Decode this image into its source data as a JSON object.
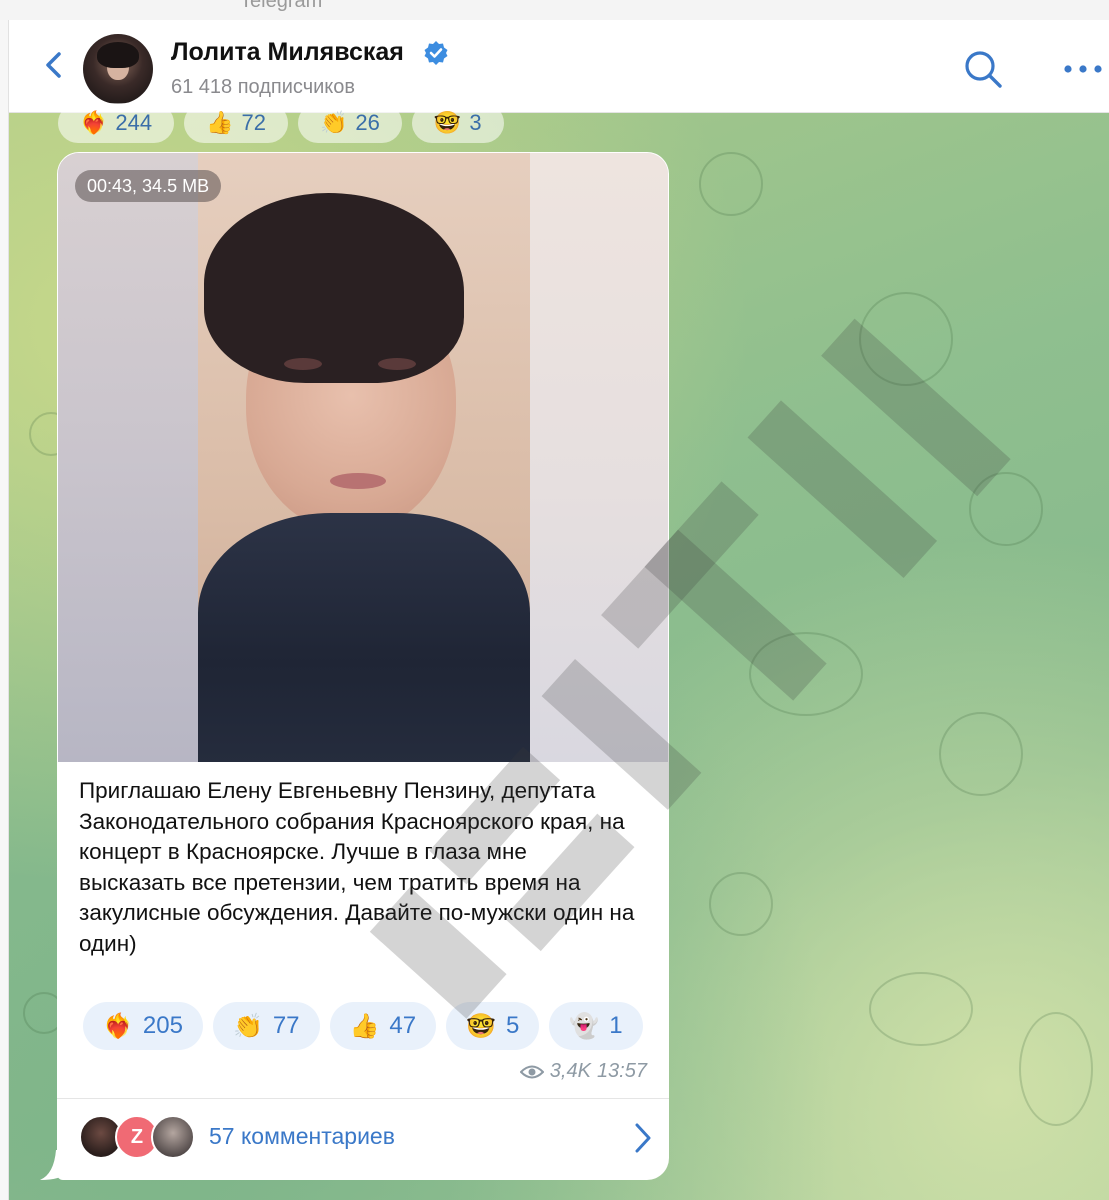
{
  "app": {
    "window_title": "Telegram"
  },
  "header": {
    "channel_name": "Лолита Милявская",
    "subscribers": "61 418 подписчиков"
  },
  "previous_post_reactions": [
    {
      "emoji": "❤️‍🔥",
      "count": "244"
    },
    {
      "emoji": "👍",
      "count": "72"
    },
    {
      "emoji": "👏",
      "count": "26"
    },
    {
      "emoji": "🤓",
      "count": "3"
    }
  ],
  "post": {
    "video_badge": "00:43, 34.5 MB",
    "text": "Приглашаю Елену Евгеньевну Пензину, депутата Законодательного собрания Красноярского края, на концерт в Красноярске. Лучше в глаза мне высказать все претензии, чем тратить время на закулисные обсуждения. Давайте по-мужски один на один)",
    "reactions": [
      {
        "emoji": "❤️‍🔥",
        "count": "205"
      },
      {
        "emoji": "👏",
        "count": "77"
      },
      {
        "emoji": "👍",
        "count": "47"
      },
      {
        "emoji": "🤓",
        "count": "5"
      },
      {
        "emoji": "👻",
        "count": "1"
      }
    ],
    "views": "3,4K",
    "time": "13:57",
    "comments": {
      "avatar_letter": "Z",
      "label": "57 комментариев"
    }
  },
  "colors": {
    "accent": "#3a78c8",
    "verified": "#3d8de0",
    "reaction_bg": "#e9f1fb"
  }
}
